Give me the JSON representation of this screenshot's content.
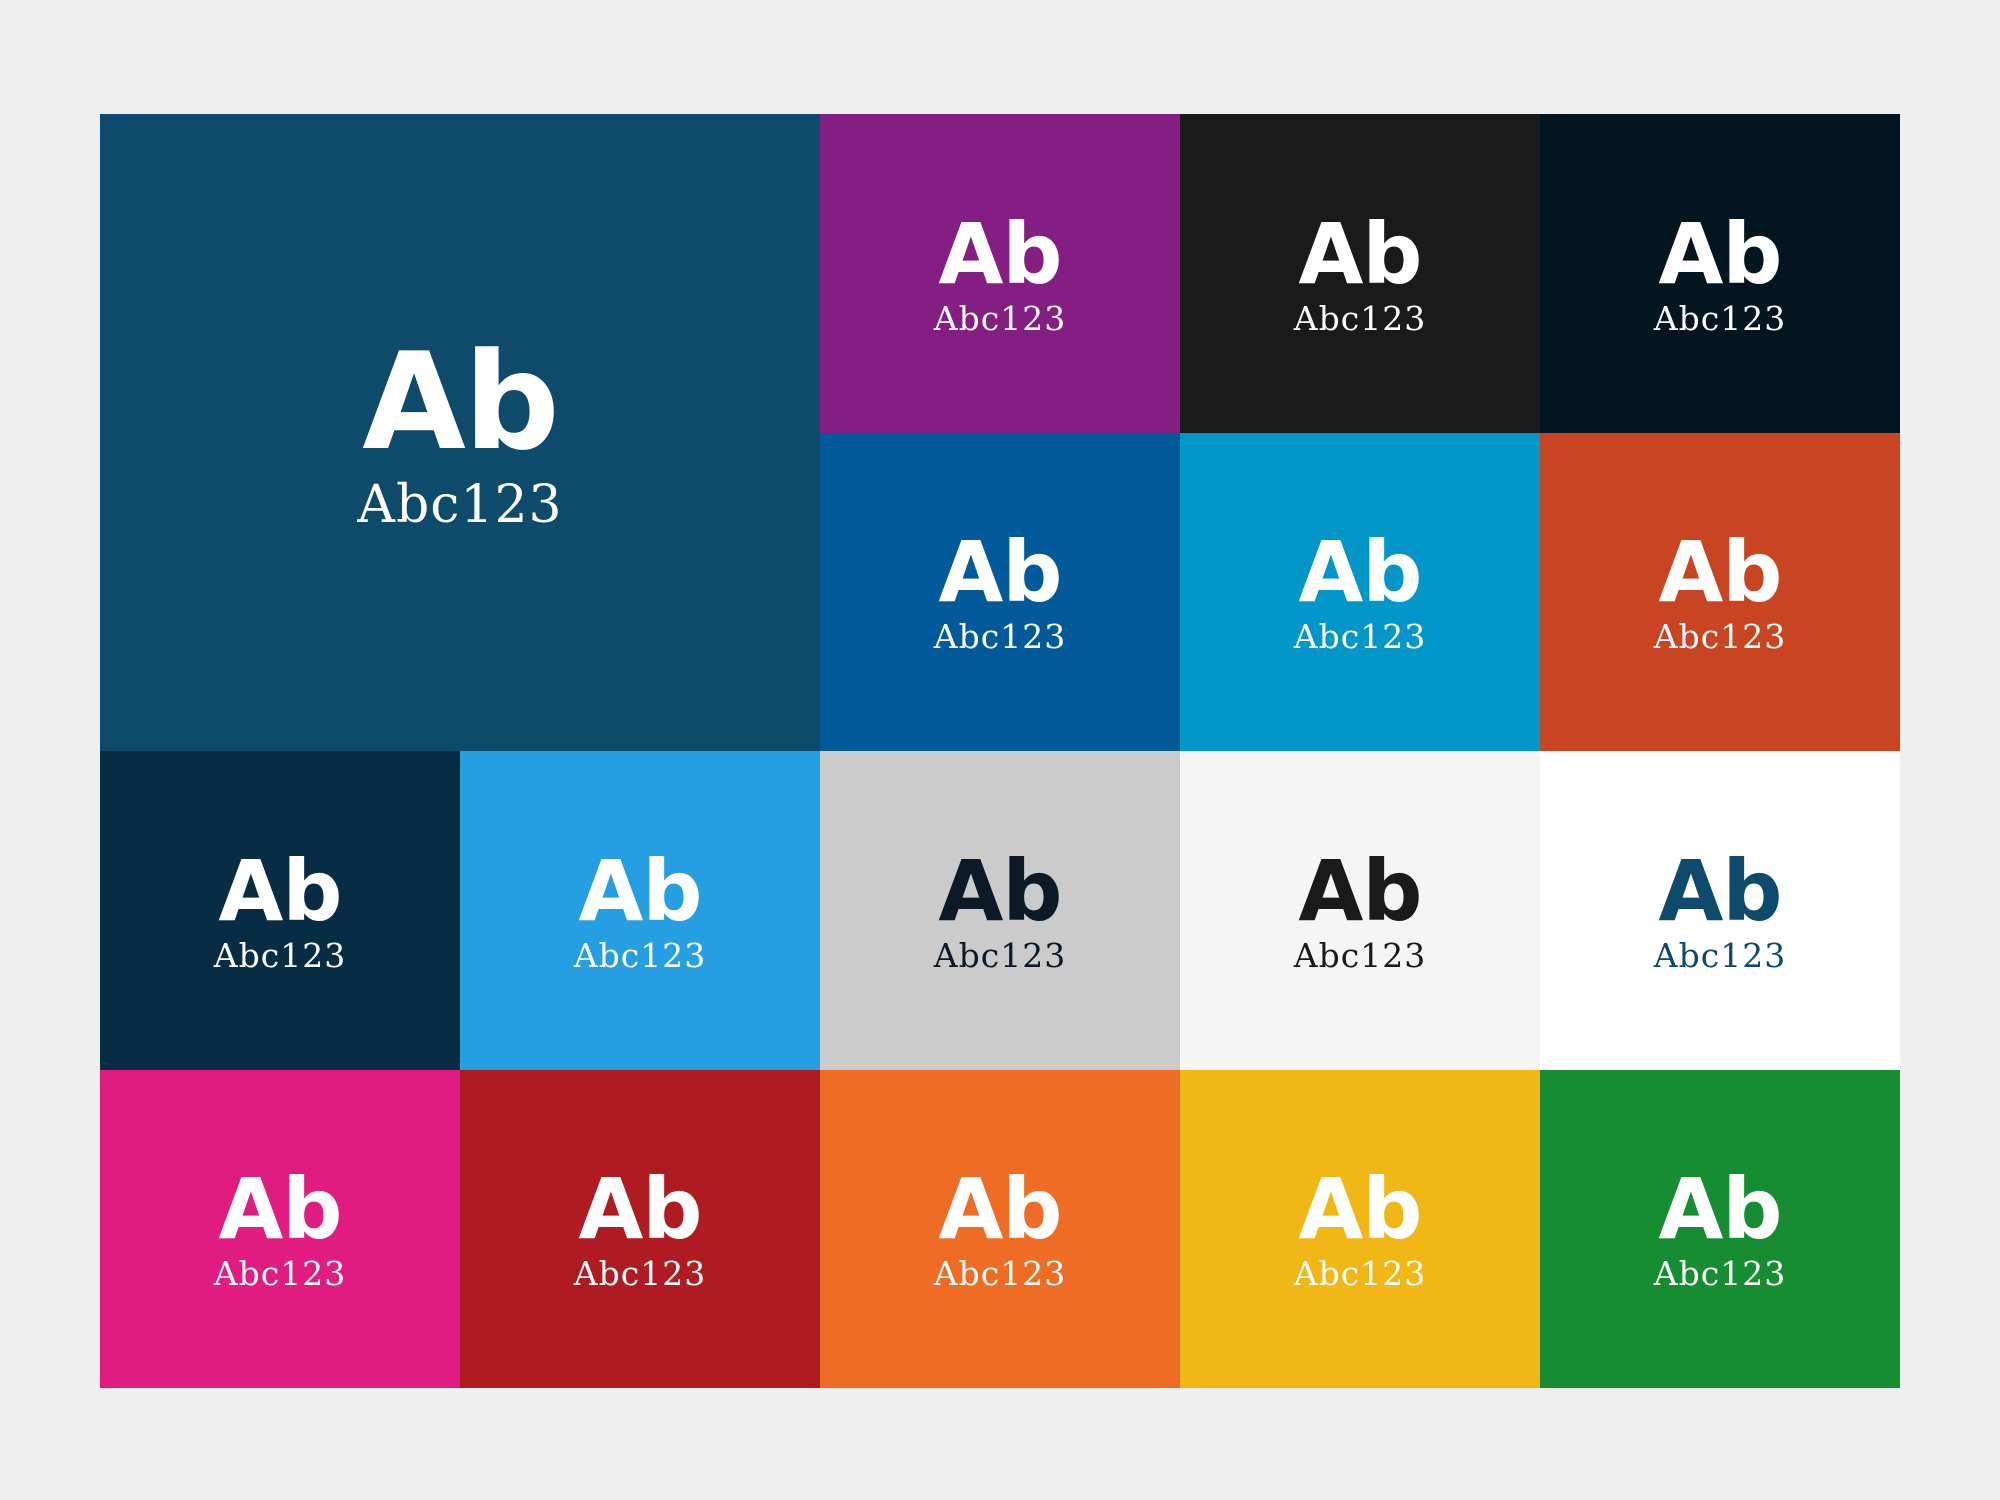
{
  "swatches": [
    {
      "id": "deep-blue",
      "bg": "#0d4a6b",
      "fg": "#ffffff",
      "headline": "Ab",
      "sample": "Abc123"
    },
    {
      "id": "purple",
      "bg": "#841e83",
      "fg": "#ffffff",
      "headline": "Ab",
      "sample": "Abc123"
    },
    {
      "id": "near-black",
      "bg": "#1a1a1a",
      "fg": "#ffffff",
      "headline": "Ab",
      "sample": "Abc123"
    },
    {
      "id": "midnight",
      "bg": "#021520",
      "fg": "#ffffff",
      "headline": "Ab",
      "sample": "Abc123"
    },
    {
      "id": "cobalt",
      "bg": "#035a9a",
      "fg": "#ffffff",
      "headline": "Ab",
      "sample": "Abc123"
    },
    {
      "id": "cyan",
      "bg": "#0396c9",
      "fg": "#ffffff",
      "headline": "Ab",
      "sample": "Abc123"
    },
    {
      "id": "rust",
      "bg": "#c94421",
      "fg": "#ffffff",
      "headline": "Ab",
      "sample": "Abc123"
    },
    {
      "id": "navy",
      "bg": "#072c44",
      "fg": "#ffffff",
      "headline": "Ab",
      "sample": "Abc123"
    },
    {
      "id": "sky",
      "bg": "#259fe2",
      "fg": "#ffffff",
      "headline": "Ab",
      "sample": "Abc123"
    },
    {
      "id": "light-grey",
      "bg": "#cbcbcb",
      "fg": "#0b1a26",
      "headline": "Ab",
      "sample": "Abc123"
    },
    {
      "id": "off-white",
      "bg": "#f5f5f5",
      "fg": "#1a1a1a",
      "headline": "Ab",
      "sample": "Abc123"
    },
    {
      "id": "white",
      "bg": "#ffffff",
      "fg": "#0d4a6b",
      "headline": "Ab",
      "sample": "Abc123"
    },
    {
      "id": "magenta",
      "bg": "#e01c80",
      "fg": "#ffffff",
      "headline": "Ab",
      "sample": "Abc123"
    },
    {
      "id": "crimson",
      "bg": "#b01b22",
      "fg": "#ffffff",
      "headline": "Ab",
      "sample": "Abc123"
    },
    {
      "id": "orange",
      "bg": "#ef6c24",
      "fg": "#ffffff",
      "headline": "Ab",
      "sample": "Abc123"
    },
    {
      "id": "yellow",
      "bg": "#f1b716",
      "fg": "#ffffff",
      "headline": "Ab",
      "sample": "Abc123"
    },
    {
      "id": "green",
      "bg": "#168d30",
      "fg": "#ffffff",
      "headline": "Ab",
      "sample": "Abc123"
    }
  ]
}
